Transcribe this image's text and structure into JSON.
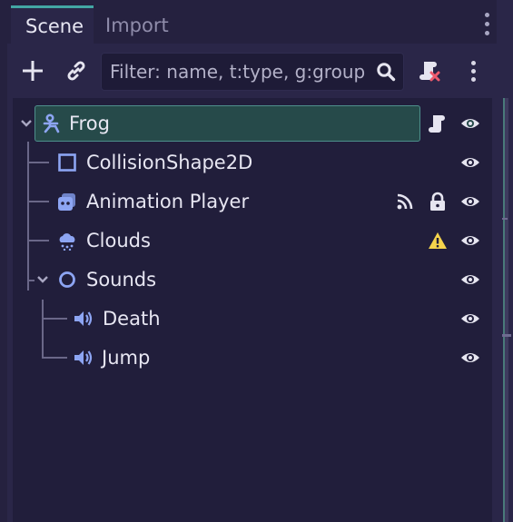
{
  "tabs": {
    "scene": "Scene",
    "import": "Import"
  },
  "toolbar": {
    "filter_placeholder": "Filter: name, t:type, g:group",
    "filter_value": ""
  },
  "tree": {
    "nodes": [
      {
        "name": "Frog",
        "icon": "character-body-icon",
        "selected": true,
        "badges": [
          "script-icon"
        ],
        "visible": true
      },
      {
        "name": "CollisionShape2D",
        "icon": "collision-shape-icon",
        "badges": [],
        "visible": true
      },
      {
        "name": "Animation Player",
        "icon": "animation-player-icon",
        "badges": [
          "signal-icon",
          "lock-icon"
        ],
        "visible": true
      },
      {
        "name": "Clouds",
        "icon": "particles-icon",
        "badges": [
          "warning-icon"
        ],
        "visible": true
      },
      {
        "name": "Sounds",
        "icon": "node-icon",
        "expanded": true,
        "badges": [],
        "visible": true
      },
      {
        "name": "Death",
        "icon": "audio-player-icon",
        "badges": [],
        "visible": true
      },
      {
        "name": "Jump",
        "icon": "audio-player-icon",
        "badges": [],
        "visible": true
      }
    ]
  },
  "colors": {
    "accent": "#43a7a4",
    "selection": "#264a4a",
    "icon_blue": "#8da5f3",
    "warning": "#f5d34c"
  }
}
